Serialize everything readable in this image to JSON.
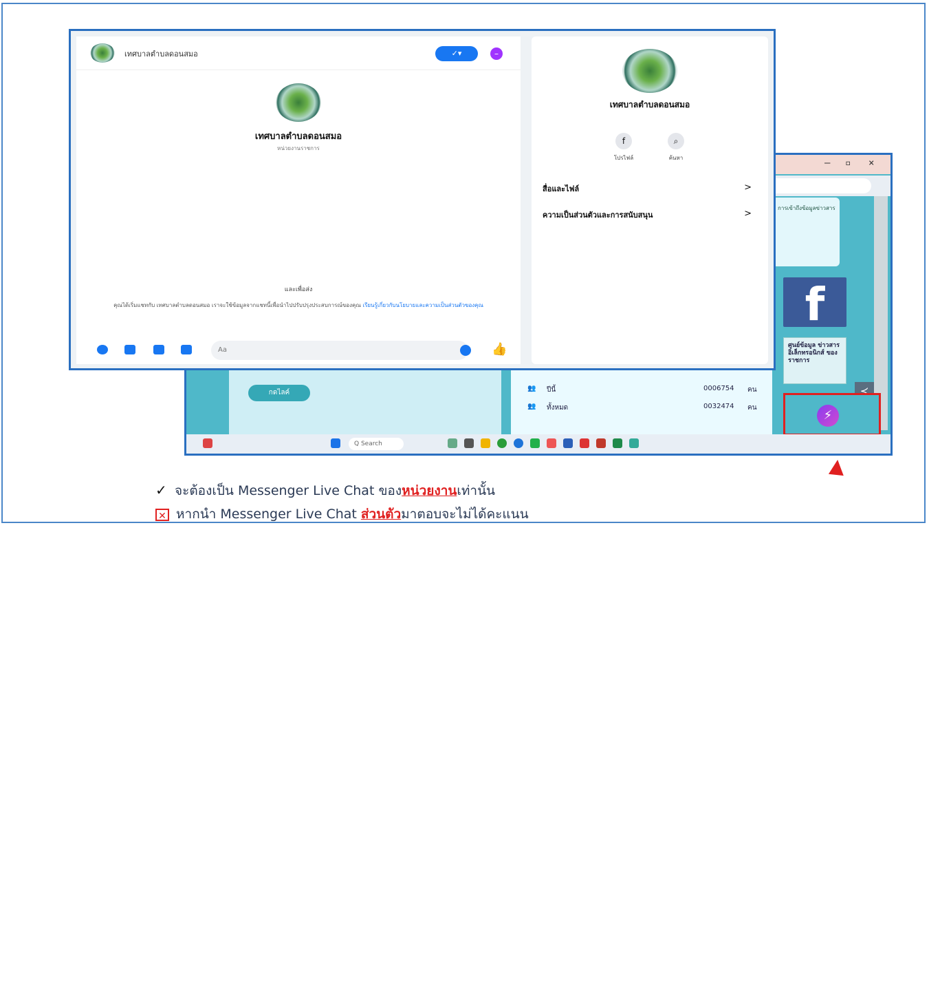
{
  "chat": {
    "page_name": "เทศบาลตำบลดอนสมอ",
    "page_type": "หน่วยงานราชการ",
    "header_button": "✓▾",
    "start_subject": "และเพื่อส่ง",
    "start_desc": "คุณได้เริ่มแชทกับ เทศบาลตำบลดอนสมอ เราจะใช้ข้อมูลจากแชทนี้เพื่อนำไปปรับปรุงประสบการณ์ของคุณ",
    "start_link": "เรียนรู้เกี่ยวกับนโยบายและความเป็นส่วนตัวของคุณ",
    "input_placeholder": "Aa"
  },
  "side": {
    "page_name": "เทศบาลตำบลดอนสมอ",
    "actions": [
      {
        "icon": "f",
        "label": "โปรไฟล์"
      },
      {
        "icon": "⌕",
        "label": "ค้นหา"
      }
    ],
    "menu": [
      {
        "label": "สื่อและไฟล์",
        "chevron": ">"
      },
      {
        "label": "ความเป็นส่วนตัวและการสนับสนุน",
        "chevron": ">"
      }
    ]
  },
  "browser": {
    "card_text": "การเข้าถึงข้อมูลข่าวสาร",
    "info_tile": "ศูนย์ข้อมูล ข่าวสาร อิเล็กทรอนิกส์ ของราชการ",
    "pill": "กดไลค์",
    "rows": [
      {
        "icon": "👥",
        "name": "ปีนี้",
        "count": "0006754",
        "unit": "คน"
      },
      {
        "icon": "👥",
        "name": "ทั้งหมด",
        "count": "0032474",
        "unit": "คน"
      }
    ],
    "search": "Q Search",
    "fb_letter": "f",
    "share_icon": "≺"
  },
  "captions": {
    "line1_pre": "จะต้องเป็น Messenger Live Chat ของ",
    "line1_red": "หน่วยงาน",
    "line1_post": "เท่านั้น",
    "line2_pre": "หากนำ Messenger Live Chat ",
    "line2_red": "ส่วนตัว",
    "line2_post": "มาตอบจะไม่ได้คะแนน"
  },
  "colors": {
    "accent": "#1877f2",
    "highlight": "#e02020"
  }
}
